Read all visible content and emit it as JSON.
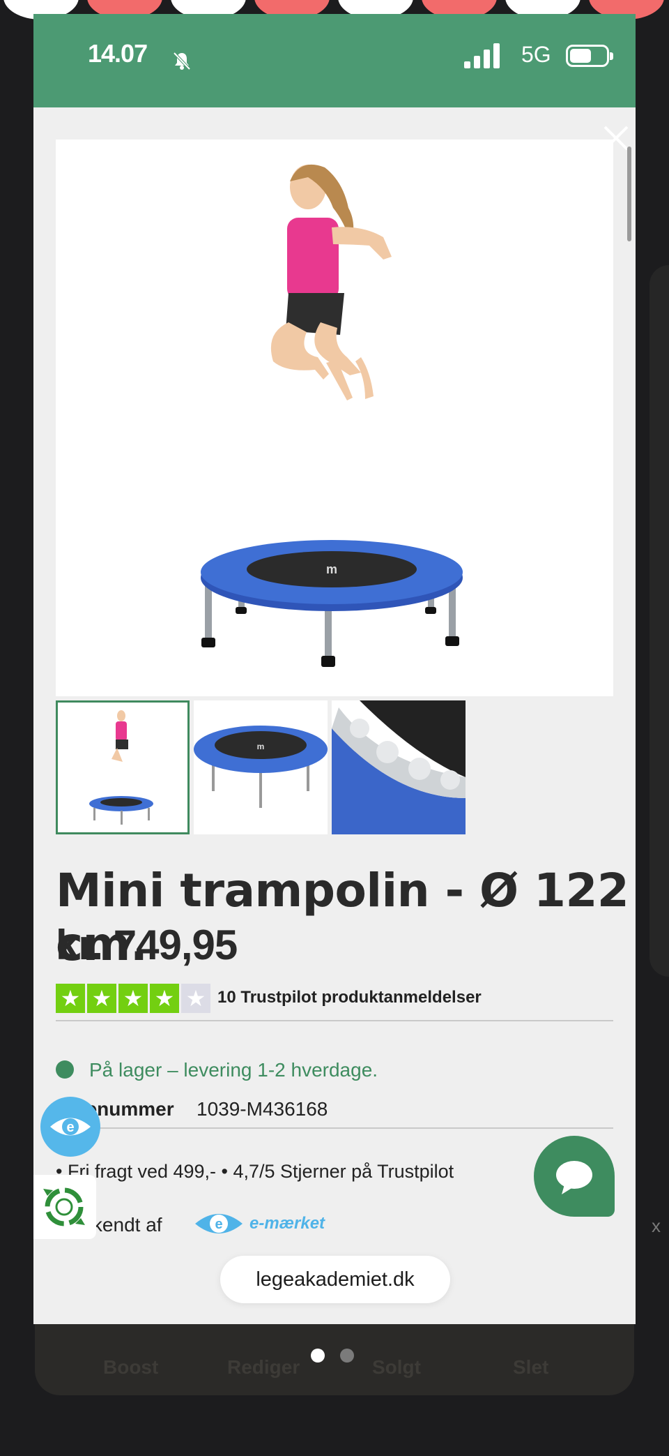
{
  "status_bar": {
    "time": "14.07",
    "network": "5G",
    "colors": {
      "background": "#4c9a73",
      "text": "#ffffff"
    }
  },
  "product": {
    "title": "Mini trampolin - Ø 122 cm.",
    "price": "kr. 749,95",
    "rating_stars": 4,
    "rating_max": 5,
    "reviews_text": "10 Trustpilot produktanmeldelser",
    "stock_text": "På lager – levering 1-2 hverdage.",
    "sku_label": "Varenummer",
    "sku_value": "1039-M436168",
    "perks_text": "• Fri fragt ved 499,-  •  4,7/5 Stjerner på Trustpilot",
    "approved_label": "Godkendt af",
    "emaerke_text": "e-mærket",
    "images": [
      "girl-jumping-on-trampoline",
      "trampoline",
      "trampoline-springs-closeup"
    ],
    "active_image": 0,
    "colors": {
      "accent": "#3e8c5f",
      "trustpilot": "#73cf11",
      "emaerke": "#4fb3e8"
    }
  },
  "browser": {
    "domain": "legeakademiet.dk"
  },
  "background_app": {
    "buttons": [
      "Boost",
      "Rediger",
      "Solgt",
      "Slet"
    ]
  },
  "pager": {
    "pages": 2,
    "current": 0
  },
  "icons": [
    "close-icon",
    "bell-muted-icon",
    "signal-icon",
    "battery-icon",
    "chat-icon",
    "e-maerket-eye-icon",
    "recycle-badge-icon"
  ]
}
